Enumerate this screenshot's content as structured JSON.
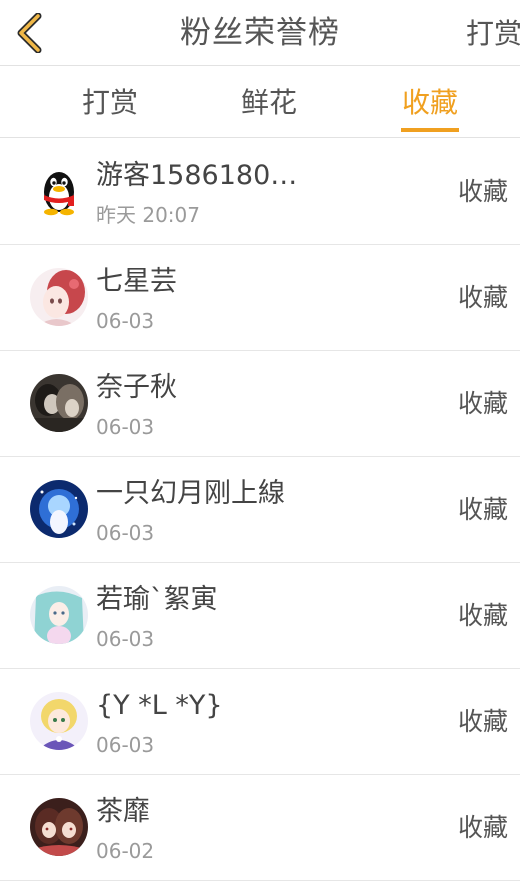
{
  "header": {
    "title": "粉丝荣誉榜",
    "right_label": "打赏"
  },
  "tabs": [
    {
      "label": "打赏"
    },
    {
      "label": "鲜花"
    },
    {
      "label": "收藏"
    }
  ],
  "active_tab": "收藏",
  "colors": {
    "accent": "#f0a020",
    "text": "#555555",
    "subtext": "#9a9a9a"
  },
  "fans": [
    {
      "name": "游客1586180…",
      "date": "昨天 20:07",
      "action": "收藏",
      "avatar": "qq-penguin-icon"
    },
    {
      "name": "七星芸",
      "date": "06-03",
      "action": "收藏",
      "avatar": "anime-girl-red-avatar"
    },
    {
      "name": "奈子秋",
      "date": "06-03",
      "action": "收藏",
      "avatar": "photo-dark-avatar"
    },
    {
      "name": "一只幻月刚上線",
      "date": "06-03",
      "action": "收藏",
      "avatar": "anime-girl-blue-avatar"
    },
    {
      "name": "若瑜`絮寅",
      "date": "06-03",
      "action": "收藏",
      "avatar": "anime-girl-teal-avatar"
    },
    {
      "name": "{Y *L *Y}",
      "date": "06-03",
      "action": "收藏",
      "avatar": "anime-girl-blonde-avatar"
    },
    {
      "name": "茶靡",
      "date": "06-02",
      "action": "收藏",
      "avatar": "anime-pair-avatar"
    }
  ]
}
